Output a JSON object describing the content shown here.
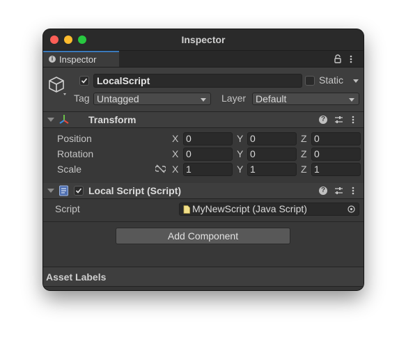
{
  "window": {
    "title": "Inspector",
    "traffic_colors": {
      "close": "#fe5f57",
      "minimize": "#febc2e",
      "maximize": "#28c840"
    }
  },
  "tab": {
    "label": "Inspector",
    "info_glyph": "i",
    "accent": "#3a79bb"
  },
  "tab_icons": [
    "lock-icon",
    "menu-dots-icon"
  ],
  "gameobject": {
    "active_checked": true,
    "name": "LocalScript",
    "static_checked": false,
    "static_label": "Static",
    "tag_label": "Tag",
    "tag_value": "Untagged",
    "layer_label": "Layer",
    "layer_value": "Default"
  },
  "transform": {
    "title": "Transform",
    "position": {
      "label": "Position",
      "x": "0",
      "y": "0",
      "z": "0"
    },
    "rotation": {
      "label": "Rotation",
      "x": "0",
      "y": "0",
      "z": "0"
    },
    "scale": {
      "label": "Scale",
      "x": "1",
      "y": "1",
      "z": "1",
      "link_icon": "unlinked-scale-icon"
    },
    "axes": {
      "x": "X",
      "y": "Y",
      "z": "Z"
    }
  },
  "local_script": {
    "enabled": true,
    "title": "Local Script (Script)",
    "script_label": "Script",
    "script_value": "MyNewScript (Java Script)"
  },
  "add_component_label": "Add Component",
  "asset_labels": "Asset Labels",
  "header_icons": {
    "help": "?",
    "presets": "presets-icon",
    "menu": "menu-dots-icon"
  }
}
